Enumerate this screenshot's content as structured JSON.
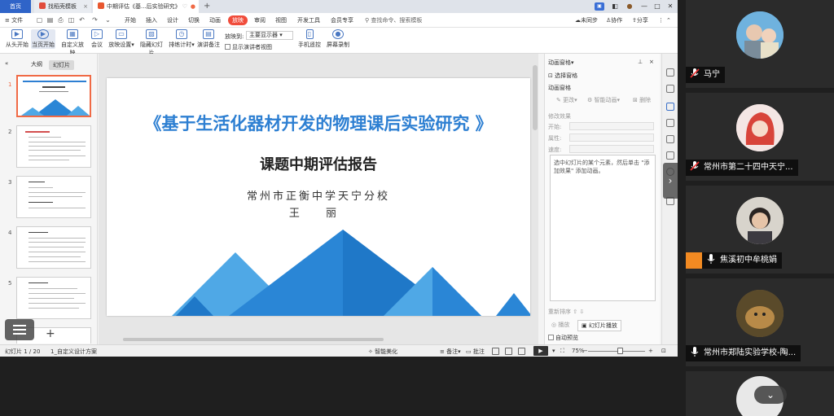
{
  "tabs": {
    "home": "首页",
    "template": "找稻壳模板",
    "document": "中期评估《基...后实验研究》"
  },
  "menu": {
    "file": "文件",
    "items": [
      "开始",
      "插入",
      "设计",
      "切换",
      "动画",
      "放映",
      "审阅",
      "视图",
      "开发工具",
      "会员专享"
    ],
    "active": "放映",
    "search": "查找命令、搜索模板",
    "unsynced": "未同步",
    "collab": "协作",
    "share": "分享"
  },
  "ribbon": {
    "from_start": "从头开始",
    "from_current": "当页开始",
    "custom_show": "自定义放映",
    "meeting": "会议",
    "setup_show": "放映设置",
    "hide_slide": "隐藏幻灯片",
    "rehearse": "排练计时",
    "record_notes": "演讲备注",
    "show_on_label": "放映到:",
    "show_on_value": "主要显示器",
    "presenter_view": "显示演讲者视图",
    "phone_remote": "手机遥控",
    "screen_record": "屏幕录制"
  },
  "left_pane": {
    "outline_tab": "大纲",
    "slides_tab": "幻灯片",
    "slide_numbers": [
      "1",
      "2",
      "3",
      "4",
      "5"
    ]
  },
  "slide": {
    "title": "《基于生活化器材开发的物理课后实验研究 》",
    "subtitle": "课题中期评估报告",
    "school": "常州市正衡中学天宁分校",
    "author": "王   丽"
  },
  "animation_pane": {
    "header": "动画窗格",
    "select_pane": "选择窗格",
    "section": "动画窗格",
    "change": "更改",
    "smart_anim": "智能动画",
    "delete": "删除",
    "modify_effect": "修改效果",
    "start": "开始:",
    "property": "属性:",
    "speed": "速度:",
    "hint": "选中幻灯片的某个元素，然后单击 \"添加效果\" 添加动画。",
    "reorder": "重新排序",
    "play": "播放",
    "slideshow": "幻灯片播放",
    "autopreview": "自动预览"
  },
  "status": {
    "slide_count": "幻灯片 1 / 20",
    "theme": "1_自定义设计方案",
    "smart_beautify": "智能美化",
    "notes": "备注",
    "comments": "批注",
    "zoom": "75%"
  },
  "participants": [
    {
      "name": "马宁",
      "mic": "muted",
      "avatar_color": "#5aa3d8"
    },
    {
      "name": "常州市第二十四中天宁...",
      "mic": "muted",
      "avatar_color": "#f1d8d8"
    },
    {
      "name": "焦溪初中牟桃娟",
      "mic": "on",
      "avatar_color": "#c9c3b8"
    },
    {
      "name": "常州市郑陆实验学校-陶...",
      "mic": "on",
      "avatar_color": "#8a6a3a"
    }
  ],
  "colors": {
    "accent_red": "#f04c3b",
    "slide_blue": "#2d7fd2",
    "mountain_dark": "#1f78c8",
    "mountain_light": "#4fa8e6"
  }
}
